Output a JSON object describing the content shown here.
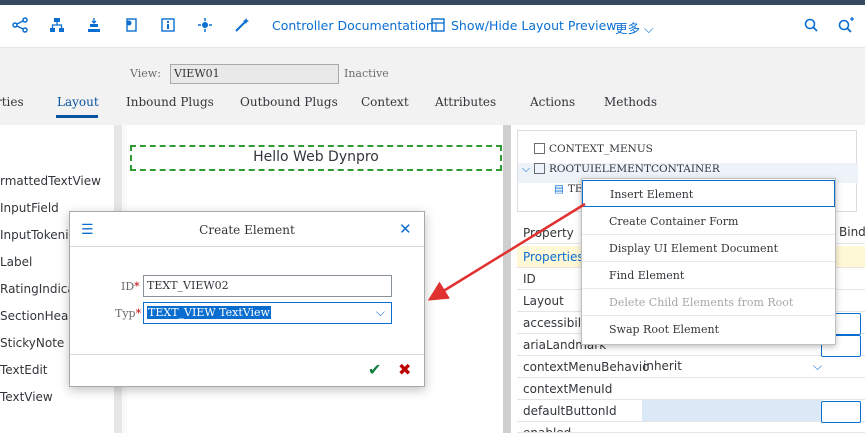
{
  "toolbar": {
    "icons": [
      "share-icon",
      "hierarchy-icon",
      "hierarchy-down-icon",
      "settings-icon",
      "info-icon",
      "activate-icon",
      "wizard-icon"
    ],
    "controller_docs": "Controller Documentation",
    "layout_preview": "Show/Hide Layout Preview",
    "more": "更多"
  },
  "view": {
    "label": "View:",
    "name": "VIEW01",
    "status": "Inactive"
  },
  "tabs": [
    "rties",
    "Layout",
    "Inbound Plugs",
    "Outbound Plugs",
    "Context",
    "Attributes",
    "Actions",
    "Methods"
  ],
  "left_pane": {
    "items": [
      "rmattedTextView",
      "InputField",
      "InputTokenize",
      "Label",
      "RatingIndicato",
      "SectionHeade",
      "StickyNote",
      "TextEdit",
      "TextView"
    ]
  },
  "canvas": {
    "hello": "Hello Web Dynpro"
  },
  "tree": {
    "rows": [
      "CONTEXT_MENUS",
      "ROOTUIELEMENTCONTAINER",
      "TE"
    ]
  },
  "properties": {
    "header": "Property",
    "header2": "Bindi",
    "section": "Properties",
    "rows": [
      {
        "name": "ID",
        "value": ""
      },
      {
        "name": "Layout",
        "value": ""
      },
      {
        "name": "accessibilit",
        "value": ""
      },
      {
        "name": "ariaLandmark",
        "value": ""
      },
      {
        "name": "contextMenuBehavio",
        "value": "inherit"
      },
      {
        "name": "contextMenuId",
        "value": ""
      },
      {
        "name": "defaultButtonId",
        "value": ""
      },
      {
        "name": "enabled",
        "value": ""
      }
    ]
  },
  "context_menu": {
    "items": [
      {
        "label": "Insert Element",
        "disabled": false
      },
      {
        "label": "Create Container Form",
        "disabled": false
      },
      {
        "label": "Display UI Element Document",
        "disabled": false
      },
      {
        "label": "Find Element",
        "disabled": false
      },
      {
        "label": "Delete Child Elements from Root",
        "disabled": true
      },
      {
        "label": "Swap Root Element",
        "disabled": false
      }
    ]
  },
  "dialog": {
    "title": "Create Element",
    "id_label": "ID",
    "id_value": "TEXT_VIEW02",
    "type_label": "Typ",
    "type_value": "TEXT_VIEW TextView"
  },
  "colors": {
    "accent": "#0a6ed1",
    "shell": "#354a5f",
    "ok": "#107e3e",
    "cancel": "#bb0000",
    "arrow": "#e03030"
  }
}
